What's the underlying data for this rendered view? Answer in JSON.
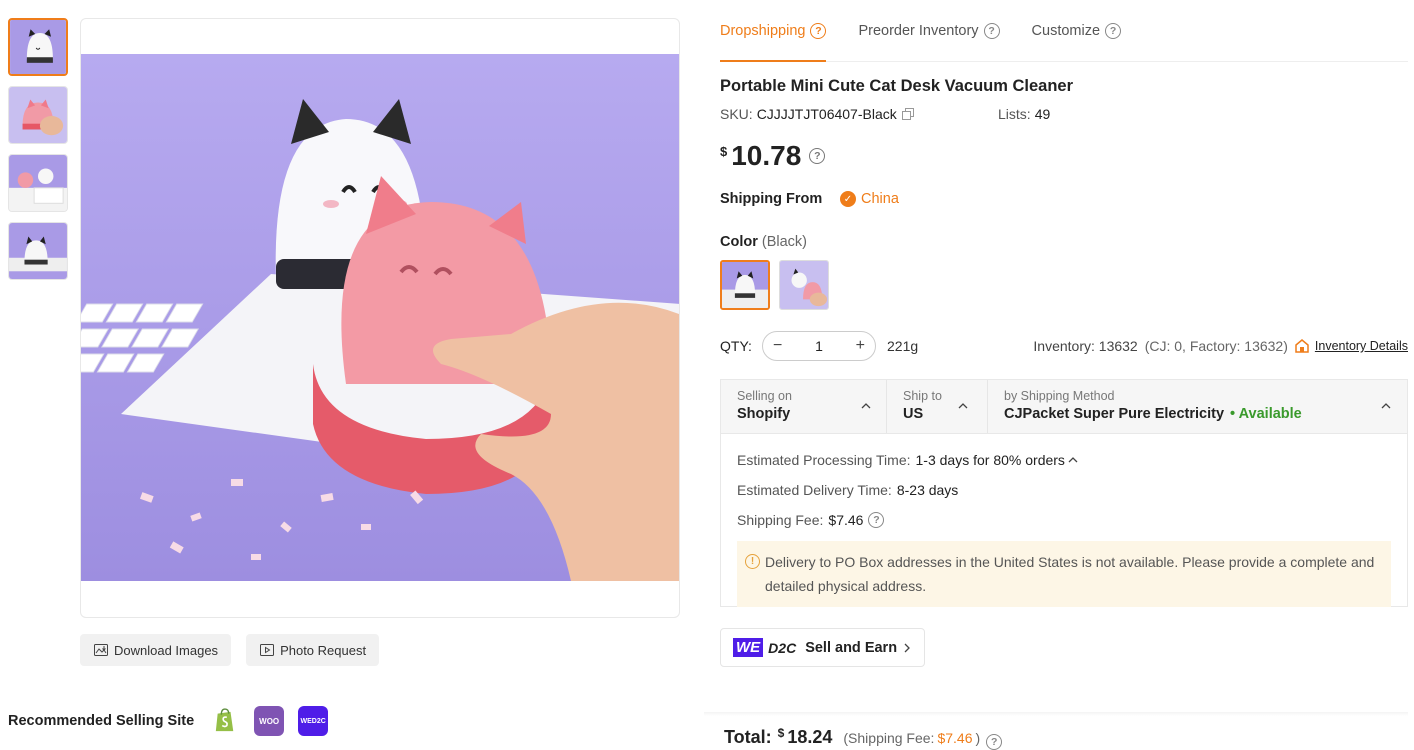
{
  "thumbnails": [
    {
      "alt": "white cat vacuum thumbnail"
    },
    {
      "alt": "pink cat vacuum thumbnail"
    },
    {
      "alt": "two vacuums thumbnail"
    },
    {
      "alt": "black cat vacuum on keyboard thumbnail"
    }
  ],
  "image_actions": {
    "download_label": "Download Images",
    "photo_request_label": "Photo Request"
  },
  "recommended": {
    "label": "Recommended Selling Site",
    "woo_text": "WOO",
    "wed2c_text": "WED2C"
  },
  "tabs": [
    {
      "label": "Dropshipping",
      "active": true
    },
    {
      "label": "Preorder Inventory",
      "active": false
    },
    {
      "label": "Customize",
      "active": false
    }
  ],
  "product": {
    "title": "Portable Mini Cute Cat Desk Vacuum Cleaner",
    "sku_label": "SKU:",
    "sku_value": "CJJJJTJT06407-Black",
    "lists_label": "Lists:",
    "lists_value": "49",
    "currency": "$",
    "price": "10.78"
  },
  "shipping_from": {
    "label": "Shipping From",
    "country": "China"
  },
  "color": {
    "label": "Color",
    "selected": "(Black)"
  },
  "quantity": {
    "label": "QTY:",
    "minus": "−",
    "value": "1",
    "plus": "+",
    "weight": "221g",
    "inventory_text": "Inventory: 13632",
    "inventory_breakdown": "(CJ: 0, Factory: 13632)",
    "inventory_link": "Inventory Details"
  },
  "shipping": {
    "selling_on_label": "Selling on",
    "selling_on_value": "Shopify",
    "ship_to_label": "Ship to",
    "ship_to_value": "US",
    "method_label": "by Shipping Method",
    "method_value": "CJPacket Super Pure Electricity",
    "availability": "• Available",
    "processing_label": "Estimated Processing Time:",
    "processing_value": "1-3 days for 80% orders",
    "delivery_label": "Estimated Delivery Time:",
    "delivery_value": "8-23 days",
    "fee_label": "Shipping Fee:",
    "fee_value": "$7.46",
    "warning": "Delivery to PO Box addresses in the United States is not available. Please provide a complete and detailed physical address."
  },
  "d2c": {
    "we": "WE",
    "d2c": "D2C",
    "label": "Sell and Earn"
  },
  "total": {
    "label": "Total:",
    "currency": "$",
    "amount": "18.24",
    "fee_label": "(Shipping Fee:",
    "fee_value": "$7.46",
    "fee_close": ")"
  },
  "colors": {
    "accent": "#ef7d1a",
    "available": "#3a9a2c",
    "image_bg": "#a99ae6",
    "warning_bg": "#fdf6e6"
  }
}
